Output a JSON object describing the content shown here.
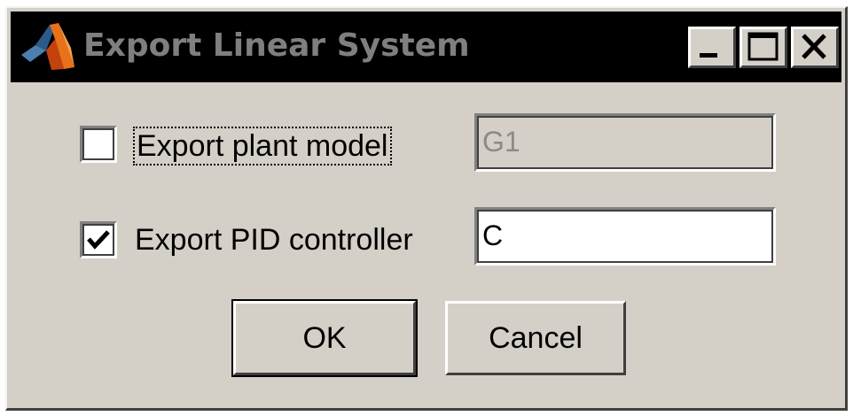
{
  "window": {
    "title": "Export Linear System",
    "icon": "matlab-logo-icon",
    "controls": {
      "minimize": "minimize-icon",
      "maximize": "maximize-icon",
      "close": "close-icon"
    }
  },
  "options": [
    {
      "label": "Export plant model",
      "checked": false,
      "value": "G1",
      "enabled": false
    },
    {
      "label": "Export PID controller",
      "checked": true,
      "value": "C",
      "enabled": true
    }
  ],
  "buttons": {
    "ok": "OK",
    "cancel": "Cancel"
  },
  "colors": {
    "dialog_bg": "#d4d0c8",
    "title_bg": "#000000",
    "title_text": "#7f7f7f",
    "disabled_text": "#8a8a8a"
  }
}
